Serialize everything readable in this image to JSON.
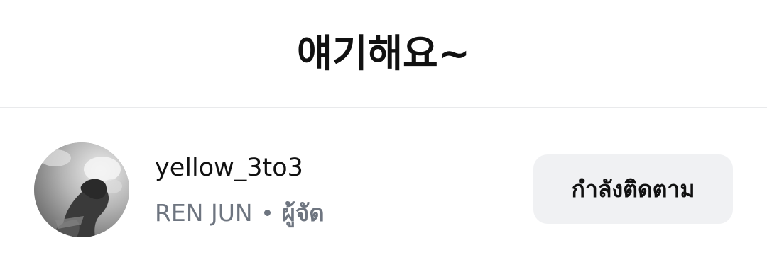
{
  "header": {
    "title": "얘기해요~"
  },
  "member": {
    "username": "yellow_3to3",
    "display_name": "REN JUN",
    "role": "ผู้จัด",
    "avatar_icon": "profile-photo",
    "follow_button_label": "กำลังติดตาม"
  },
  "colors": {
    "title_text": "#111111",
    "secondary_text": "#6e7580",
    "button_bg": "#f0f1f3",
    "divider": "#e9eaec"
  }
}
